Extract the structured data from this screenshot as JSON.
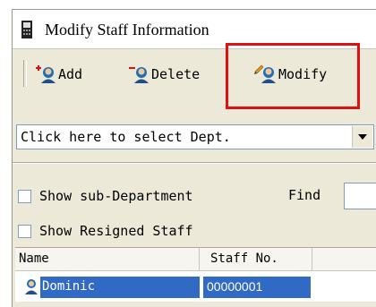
{
  "window": {
    "title": "Modify Staff Information"
  },
  "toolbar": {
    "add_label": "Add",
    "delete_label": "Delete",
    "modify_label": "Modify"
  },
  "dept_select": {
    "value": "Click here to select Dept."
  },
  "options": {
    "show_sub_department": {
      "label": "Show sub-Department",
      "checked": false
    },
    "show_resigned_staff": {
      "label": "Show Resigned Staff",
      "checked": false
    }
  },
  "find": {
    "label": "Find",
    "value": ""
  },
  "grid": {
    "columns": [
      "Name",
      "Staff No."
    ],
    "rows": [
      {
        "name": "Dominic",
        "staff_no": "00000001",
        "selected": true
      }
    ]
  },
  "colors": {
    "highlight_box": "#e01010",
    "selection": "#316ac5",
    "add_mark": "#e01010",
    "delete_mark": "#e01010"
  },
  "icons": {
    "title": "phone-book-icon",
    "add": "add-person-icon",
    "delete": "delete-person-icon",
    "modify": "edit-person-icon",
    "row": "person-icon"
  }
}
